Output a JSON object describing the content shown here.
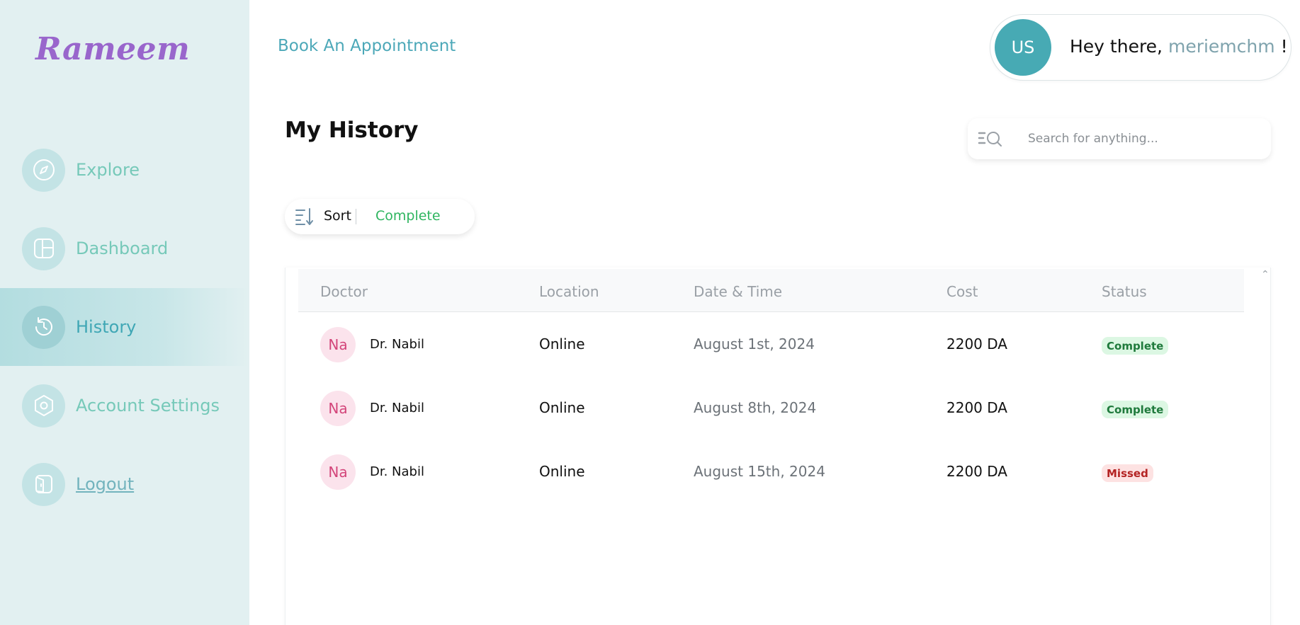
{
  "app": {
    "logo_text": "Rameem"
  },
  "sidebar": {
    "items": [
      {
        "label": "Explore",
        "icon": "compass-icon",
        "active": false
      },
      {
        "label": "Dashboard",
        "icon": "layout-icon",
        "active": false
      },
      {
        "label": "History",
        "icon": "history-icon",
        "active": true
      },
      {
        "label": "Account Settings",
        "icon": "settings-icon",
        "active": false
      },
      {
        "label": "Logout",
        "icon": "logout-icon",
        "active": false
      }
    ]
  },
  "header": {
    "book_link": "Book An Appointment",
    "user": {
      "initials": "US",
      "greeting_prefix": "Hey there,",
      "username": "meriemchm",
      "greeting_suffix": "!"
    }
  },
  "page": {
    "title": "My History"
  },
  "search": {
    "placeholder": "Search for anything..."
  },
  "sort": {
    "label": "Sort",
    "value": "Complete"
  },
  "table": {
    "headers": [
      "Doctor",
      "Location",
      "Date & Time",
      "Cost",
      "Status"
    ],
    "rows": [
      {
        "initials": "Na",
        "doctor": "Dr. Nabil",
        "location": "Online",
        "date": "August 1st, 2024",
        "cost": "2200 DA",
        "status": "Complete"
      },
      {
        "initials": "Na",
        "doctor": "Dr. Nabil",
        "location": "Online",
        "date": "August 8th, 2024",
        "cost": "2200 DA",
        "status": "Complete"
      },
      {
        "initials": "Na",
        "doctor": "Dr. Nabil",
        "location": "Online",
        "date": "August 15th, 2024",
        "cost": "2200 DA",
        "status": "Missed"
      }
    ]
  },
  "colors": {
    "sidebar_bg": "#e2f0f1",
    "accent": "#47aab4",
    "logo": "#9966cc",
    "status_complete": "#1f7a3c",
    "status_missed": "#b42323"
  }
}
